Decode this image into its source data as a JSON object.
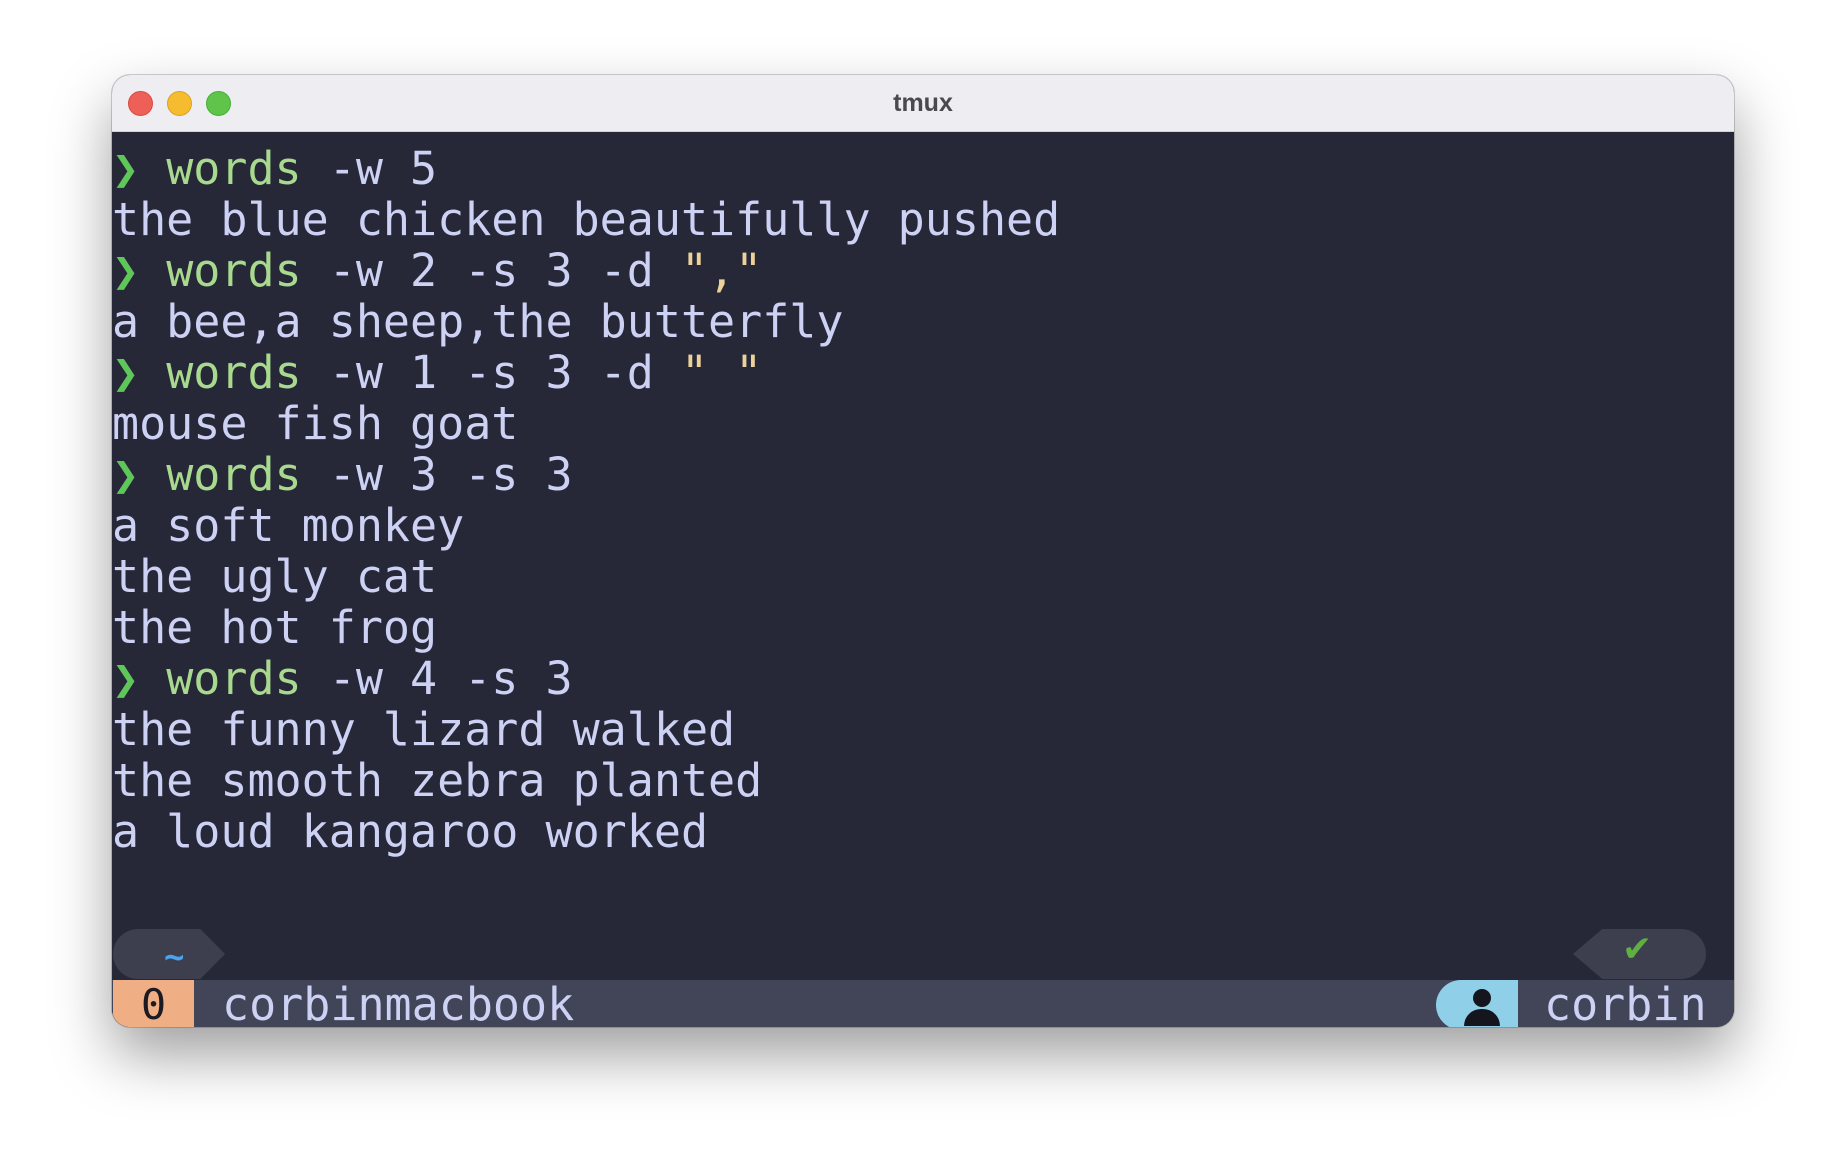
{
  "window": {
    "title": "tmux"
  },
  "terminal": {
    "prompt_symbol": "❯",
    "entries": [
      {
        "cmd": "words",
        "args": " -w 5",
        "str": "",
        "output": [
          "the blue chicken beautifully pushed"
        ]
      },
      {
        "cmd": "words",
        "args": " -w 2 -s 3 -d ",
        "str": "\",\"",
        "output": [
          "a bee,a sheep,the butterfly"
        ]
      },
      {
        "cmd": "words",
        "args": " -w 1 -s 3 -d ",
        "str": "\" \"",
        "output": [
          "mouse fish goat"
        ]
      },
      {
        "cmd": "words",
        "args": " -w 3 -s 3",
        "str": "",
        "output": [
          "a soft monkey",
          "the ugly cat",
          "the hot frog"
        ]
      },
      {
        "cmd": "words",
        "args": " -w 4 -s 3",
        "str": "",
        "output": [
          "the funny lizard walked",
          "the smooth zebra planted",
          "a loud kangaroo worked"
        ]
      }
    ]
  },
  "status": {
    "cwd_symbol": "~",
    "exit_status_symbol": "✔",
    "window_index": "0",
    "hostname": "corbinmacbook",
    "user_icon": "user-icon",
    "username": "corbin"
  },
  "colors": {
    "terminal_bg": "#262837",
    "prompt": "#5fc65a",
    "command": "#a8d98e",
    "text": "#cdd1f3",
    "string": "#edd19a",
    "status_bar": "#424457",
    "window_index_bg": "#efae84",
    "user_bg": "#8fd0e8"
  }
}
